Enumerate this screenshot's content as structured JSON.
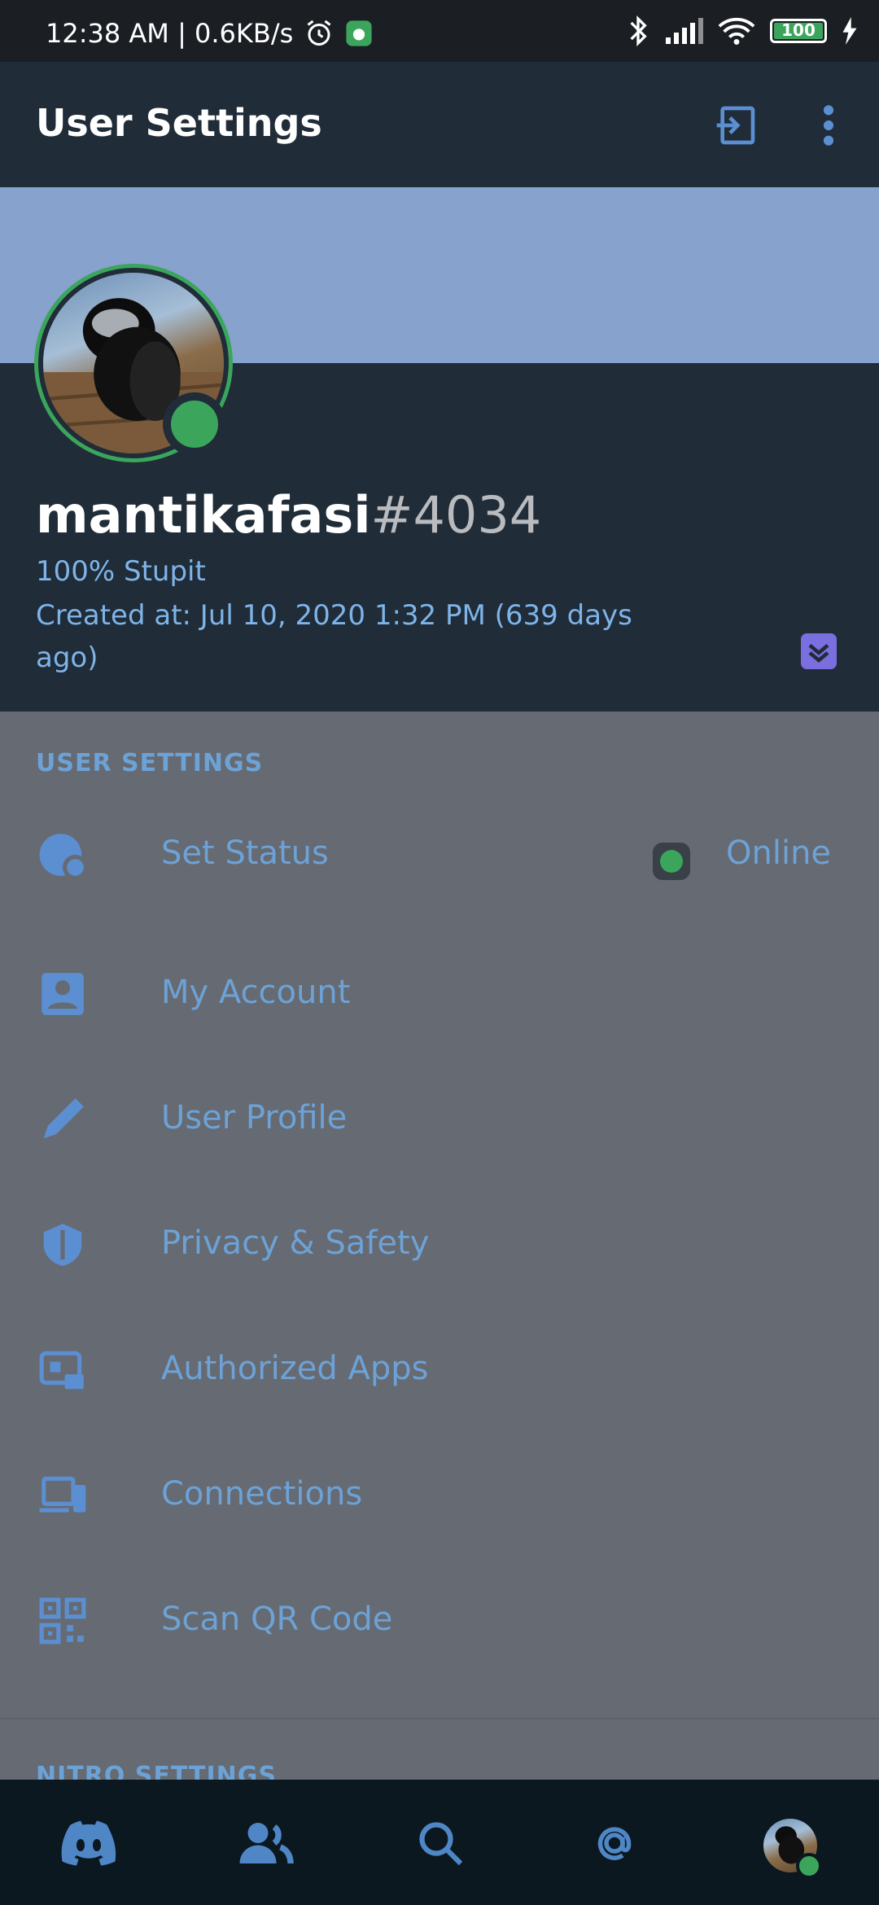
{
  "status_bar": {
    "time_speed": "12:38 AM | 0.6KB/s",
    "battery": "100"
  },
  "header": {
    "title": "User Settings"
  },
  "profile": {
    "username": "mantikafasi",
    "discriminator": "#4034",
    "custom_status": "100% Stupit",
    "created_line1": "Created at: Jul 10, 2020 1:32 PM (639 days",
    "created_line2": "ago)",
    "presence_color": "#3ba55c"
  },
  "user_settings": {
    "section_title": "USER SETTINGS",
    "items": [
      {
        "label": "Set Status",
        "icon": "status-icon",
        "value": "Online"
      },
      {
        "label": "My Account",
        "icon": "account-icon"
      },
      {
        "label": "User Profile",
        "icon": "pencil-icon"
      },
      {
        "label": "Privacy & Safety",
        "icon": "shield-icon"
      },
      {
        "label": "Authorized Apps",
        "icon": "apps-icon"
      },
      {
        "label": "Connections",
        "icon": "devices-icon"
      },
      {
        "label": "Scan QR Code",
        "icon": "qr-icon"
      }
    ]
  },
  "nitro_settings": {
    "section_title": "NITRO SETTINGS"
  },
  "bottom_nav": [
    {
      "icon": "discord-icon"
    },
    {
      "icon": "friends-icon"
    },
    {
      "icon": "search-icon"
    },
    {
      "icon": "mentions-icon"
    },
    {
      "icon": "profile-avatar"
    }
  ],
  "colors": {
    "accent_text": "#6da2d6",
    "online": "#3ba55c",
    "banner": "#87a2cc",
    "header_bg": "#202c38"
  }
}
